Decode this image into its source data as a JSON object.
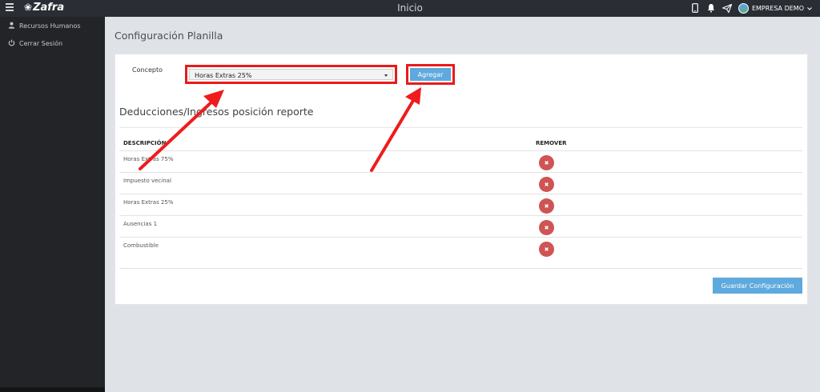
{
  "app": {
    "brand": "Zafra",
    "title": "Inicio",
    "company": "EMPRESA DEMO"
  },
  "sidebar": {
    "items": [
      {
        "label": "Recursos Humanos"
      },
      {
        "label": "Cerrar Sesión"
      }
    ]
  },
  "page": {
    "title": "Configuración Planilla"
  },
  "form": {
    "concepto_label": "Concepto",
    "selected_value": "Horas Extras 25%",
    "add_button": "Agregar"
  },
  "section": {
    "title": "Deducciones/Ingresos posición reporte"
  },
  "table": {
    "headers": {
      "description": "DESCRIPCIÓN",
      "remove": "REMOVER"
    },
    "rows": [
      {
        "description": "Horas Extras 75%"
      },
      {
        "description": "Impuesto vecinal"
      },
      {
        "description": "Horas Extras 25%"
      },
      {
        "description": "Ausencias 1"
      },
      {
        "description": "Combustible"
      }
    ],
    "remove_glyph": "✖"
  },
  "actions": {
    "save_button": "Guardar Configuración"
  },
  "colors": {
    "accent": "#5ea9dd",
    "danger": "#cf5454",
    "highlight": "#e81b1b",
    "topbar": "#2a2d33",
    "sidebar": "#222428"
  }
}
